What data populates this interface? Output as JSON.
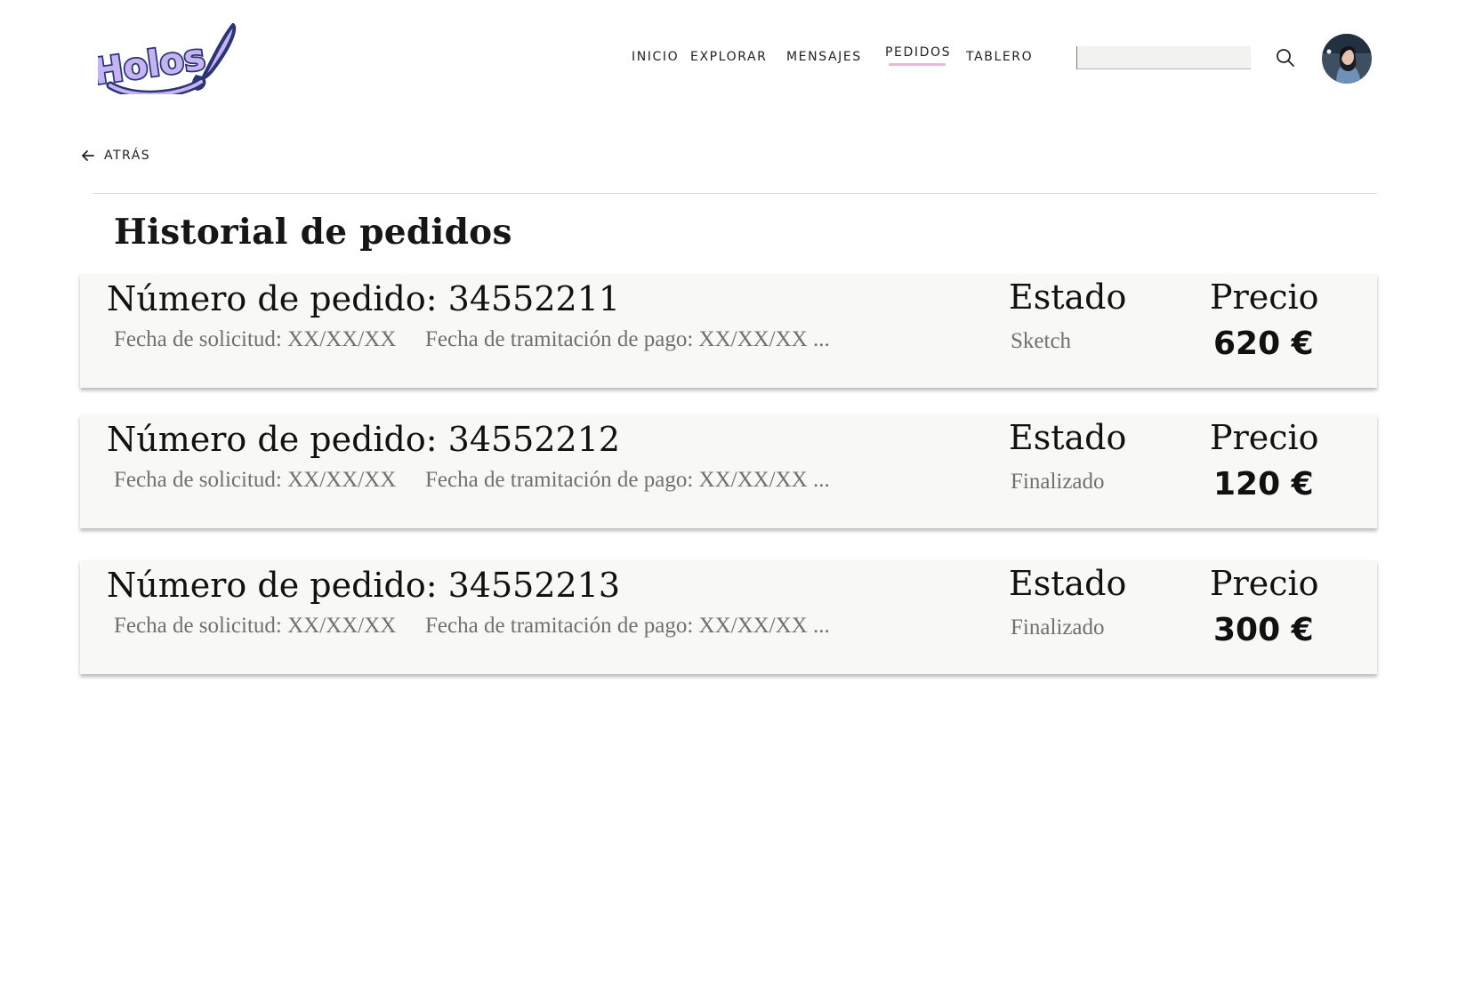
{
  "brand": {
    "logo_text": "Holos",
    "logo_fill": "#c4b5f0",
    "logo_outline": "#2b3475"
  },
  "nav": {
    "items": [
      {
        "label": "INICIO",
        "active": false
      },
      {
        "label": "EXPLORAR",
        "active": false
      },
      {
        "label": "MENSAJES",
        "active": false
      },
      {
        "label": "PEDIDOS",
        "active": true
      },
      {
        "label": "TABLERO",
        "active": false
      }
    ],
    "active_color": "#f2b3d9"
  },
  "search": {
    "value": "",
    "placeholder": ""
  },
  "back": {
    "label": "ATRÁS"
  },
  "page": {
    "title": "Historial de pedidos"
  },
  "orders": [
    {
      "number": "Número de pedido: 34552211",
      "request_date": "Fecha de solicitud: XX/XX/XX",
      "payment_date": "Fecha de tramitación de pago: XX/XX/XX ...",
      "status_label": "Estado",
      "status": "Sketch",
      "price_label": "Precio",
      "price": "620 €"
    },
    {
      "number": "Número de pedido: 34552212",
      "request_date": "Fecha de solicitud: XX/XX/XX",
      "payment_date": "Fecha de tramitación de pago: XX/XX/XX ...",
      "status_label": "Estado",
      "status": "Finalizado",
      "price_label": "Precio",
      "price": "120 €"
    },
    {
      "number": "Número de pedido: 34552213",
      "request_date": "Fecha de solicitud: XX/XX/XX",
      "payment_date": "Fecha de tramitación de pago: XX/XX/XX ...",
      "status_label": "Estado",
      "status": "Finalizado",
      "price_label": "Precio",
      "price": "300 €"
    }
  ]
}
